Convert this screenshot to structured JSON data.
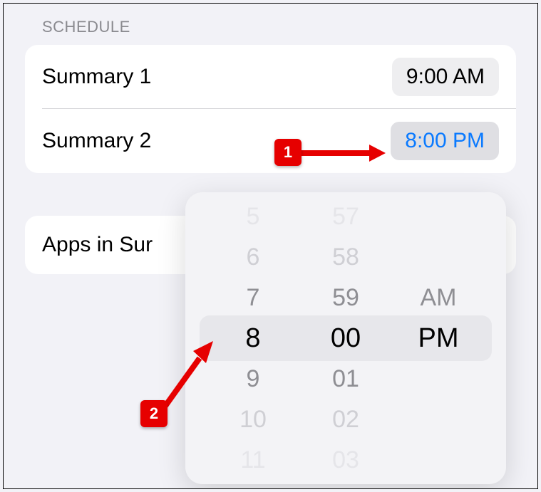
{
  "section_header": "SCHEDULE",
  "rows": [
    {
      "label": "Summary 1",
      "time": "9:00 AM"
    },
    {
      "label": "Summary 2",
      "time": "8:00 PM"
    }
  ],
  "apps_row_partial": "Apps in Sur",
  "picker": {
    "hours": [
      "5",
      "6",
      "7",
      "8",
      "9",
      "10",
      "11"
    ],
    "minutes": [
      "57",
      "58",
      "59",
      "00",
      "01",
      "02",
      "03"
    ],
    "period": [
      "",
      "",
      "AM",
      "PM",
      "",
      "",
      ""
    ]
  },
  "callouts": {
    "one": "1",
    "two": "2"
  }
}
